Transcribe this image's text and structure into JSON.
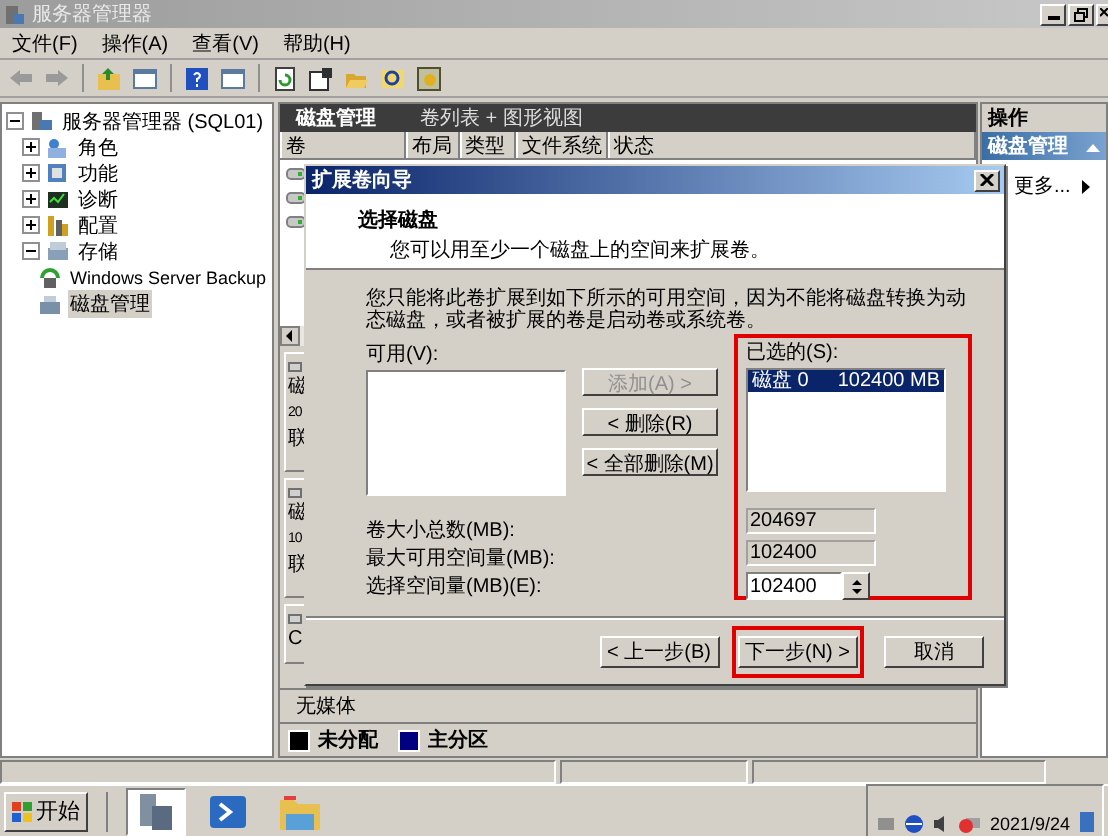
{
  "window": {
    "title": "服务器管理器"
  },
  "menu": [
    "文件(F)",
    "操作(A)",
    "查看(V)",
    "帮助(H)"
  ],
  "tree": {
    "label": "服务器管理器 (SQL01)",
    "selected": false,
    "expanded": true,
    "children": [
      {
        "label": "角色",
        "selected": false,
        "expanded": false
      },
      {
        "label": "功能",
        "selected": false,
        "expanded": false
      },
      {
        "label": "诊断",
        "selected": false,
        "expanded": false
      },
      {
        "label": "配置",
        "selected": false,
        "expanded": false
      },
      {
        "label": "存储",
        "selected": false,
        "expanded": true,
        "children": [
          {
            "label": "Windows Server Backup",
            "selected": false
          },
          {
            "label": "磁盘管理",
            "selected": true
          }
        ]
      }
    ]
  },
  "disk_management": {
    "title": "磁盘管理",
    "view": "卷列表 + 图形视图",
    "columns": [
      "卷",
      "布局",
      "类型",
      "文件系统",
      "状态"
    ],
    "disks": [
      {
        "lines": [
          "磁",
          "20",
          "联"
        ]
      },
      {
        "lines": [
          "磁",
          "10",
          "联"
        ]
      },
      {
        "lines": [
          "C"
        ]
      }
    ],
    "no_media": "无媒体",
    "legend": [
      {
        "label": "未分配",
        "color": "#000000"
      },
      {
        "label": "主分区",
        "color": "#000080"
      }
    ]
  },
  "actions": {
    "title": "操作",
    "section": "磁盘管理",
    "items": [
      "更多..."
    ]
  },
  "wizard": {
    "title": "扩展卷向导",
    "heading": "选择磁盘",
    "subheading": "您可以用至少一个磁盘上的空间来扩展卷。",
    "note": "您只能将此卷扩展到如下所示的可用空间，因为不能将磁盘转换为动态磁盘，或者被扩展的卷是启动卷或系统卷。",
    "available_label": "可用(V):",
    "move_buttons": [
      {
        "label": "添加(A) >",
        "disabled": true
      },
      {
        "label": "< 删除(R)",
        "disabled": false
      },
      {
        "label": "< 全部删除(M)",
        "disabled": false
      }
    ],
    "selected_panel": {
      "label": "已选的(S):",
      "highlighted": true,
      "items": [
        {
          "disk": "磁盘 0",
          "size": "102400 MB",
          "selected": true
        }
      ]
    },
    "fields": [
      {
        "label": "卷大小总数(MB):",
        "value": "204697",
        "kind": "readonly"
      },
      {
        "label": "最大可用空间量(MB):",
        "value": "102400",
        "kind": "readonly"
      },
      {
        "label": "选择空间量(MB)(E):",
        "value": "102400",
        "kind": "spin"
      }
    ],
    "buttons": [
      {
        "label": "< 上一步(B)",
        "highlighted": false
      },
      {
        "label": "下一步(N) >",
        "highlighted": true
      },
      {
        "label": "取消",
        "highlighted": false
      }
    ]
  },
  "taskbar": {
    "start": "开始",
    "date": "2021/9/24"
  }
}
